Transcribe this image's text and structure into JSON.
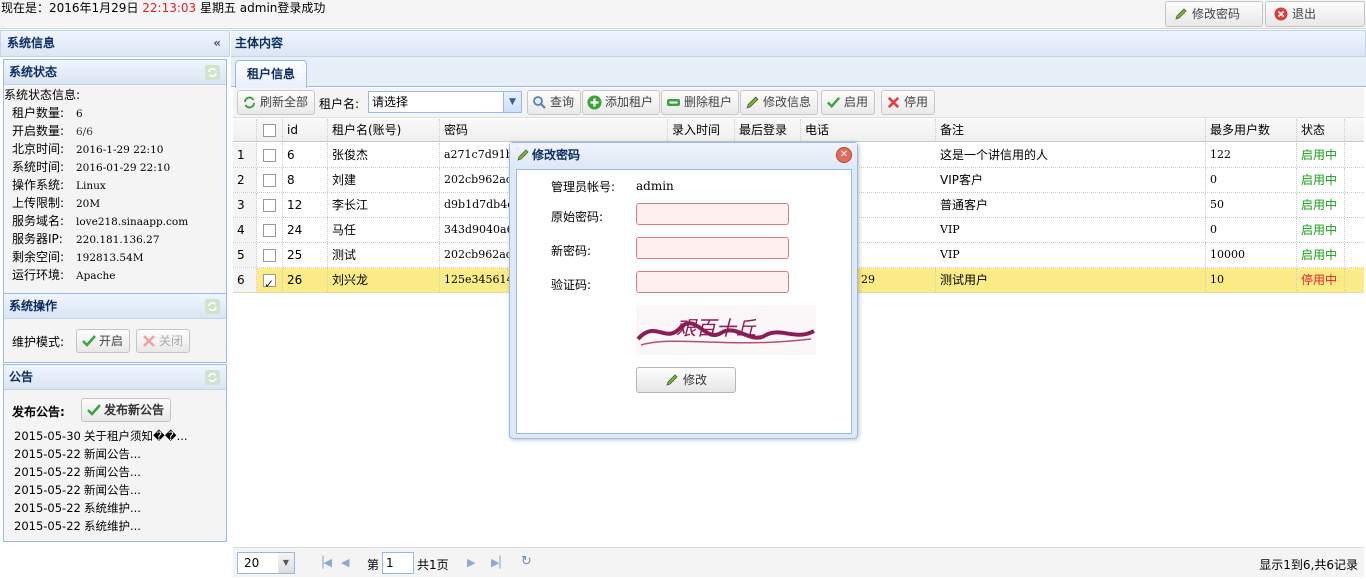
{
  "topbar": {
    "prefix": "现在是：2016年1月29日 ",
    "time": "22:13:03",
    "suffix": " 星期五 admin登录成功",
    "change_password": "修改密码",
    "logout": "退出"
  },
  "west": {
    "title": "系统信息",
    "status_panel": {
      "title": "系统状态",
      "heading": "系统状态信息:",
      "items": [
        {
          "k": "租户数量:",
          "v": "6"
        },
        {
          "k": "开启数量:",
          "v": "6/6"
        },
        {
          "k": "北京时间:",
          "v": "2016-1-29 22:10"
        },
        {
          "k": "系统时间:",
          "v": "2016-01-29 22:10"
        },
        {
          "k": "操作系统:",
          "v": "Linux"
        },
        {
          "k": "上传限制:",
          "v": "20M"
        },
        {
          "k": "服务域名:",
          "v": "love218.sinaapp.com"
        },
        {
          "k": "服务器IP:",
          "v": "220.181.136.27"
        },
        {
          "k": "剩余空间:",
          "v": "192813.54M"
        },
        {
          "k": "运行环境:",
          "v": "Apache"
        }
      ]
    },
    "ops_panel": {
      "title": "系统操作",
      "maintenance_label": "维护模式:",
      "on_label": "开启",
      "off_label": "关闭"
    },
    "notice_panel": {
      "title": "公告",
      "publish_label": "发布公告:",
      "publish_button": "发布新公告",
      "items": [
        {
          "date": "2015-05-30",
          "title": "关于租户须知��..."
        },
        {
          "date": "2015-05-22",
          "title": "新闻公告..."
        },
        {
          "date": "2015-05-22",
          "title": "新闻公告..."
        },
        {
          "date": "2015-05-22",
          "title": "新闻公告..."
        },
        {
          "date": "2015-05-22",
          "title": "系统维护..."
        },
        {
          "date": "2015-05-22",
          "title": "系统维护..."
        }
      ]
    }
  },
  "center": {
    "title": "主体内容",
    "tab": "租户信息",
    "toolbar": {
      "refresh": "刷新全部",
      "tenant_label": "租户名:",
      "tenant_select": "请选择",
      "query": "查询",
      "add": "添加租户",
      "delete": "删除租户",
      "edit": "修改信息",
      "enable": "启用",
      "disable": "停用"
    },
    "grid": {
      "columns": [
        "id",
        "租户名(账号)",
        "密码",
        "录入时间",
        "最后登录",
        "电话",
        "备注",
        "最多用户数",
        "状态"
      ],
      "rows": [
        {
          "n": "1",
          "id": "6",
          "name": "张俊杰",
          "pwd": "a271c7d91b",
          "last": "",
          "remark": "这是一个讲信用的人",
          "max": "122",
          "status": "启用中",
          "checked": false
        },
        {
          "n": "2",
          "id": "8",
          "name": "刘建",
          "pwd": "202cb962ac5",
          "last": "",
          "remark": "VIP客户",
          "max": "0",
          "status": "启用中",
          "checked": false
        },
        {
          "n": "3",
          "id": "12",
          "name": "李长江",
          "pwd": "d9b1d7db4c",
          "last": "",
          "remark": "普通客户",
          "max": "50",
          "status": "启用中",
          "checked": false
        },
        {
          "n": "4",
          "id": "24",
          "name": "马任",
          "pwd": "343d9040a6",
          "last": "",
          "remark": "VIP",
          "max": "0",
          "status": "启用中",
          "checked": false
        },
        {
          "n": "5",
          "id": "25",
          "name": "测试",
          "pwd": "202cb962ac5",
          "last": "",
          "remark": "VIP",
          "max": "10000",
          "status": "启用中",
          "checked": false
        },
        {
          "n": "6",
          "id": "26",
          "name": "刘兴龙",
          "pwd": "125e3456148",
          "last": "29",
          "remark": "测试用户",
          "max": "10",
          "status": "停用中",
          "checked": true
        }
      ]
    },
    "pager": {
      "page_size": "20",
      "page_prefix": "第",
      "page": "1",
      "page_suffix": "共1页",
      "info": "显示1到6,共6记录"
    }
  },
  "dialog": {
    "title": "修改密码",
    "account_label": "管理员帐号:",
    "account_value": "admin",
    "old_pwd_label": "原始密码:",
    "new_pwd_label": "新密码:",
    "captcha_label": "验证码:",
    "captcha_text": "艰百十丘",
    "submit": "修改"
  }
}
